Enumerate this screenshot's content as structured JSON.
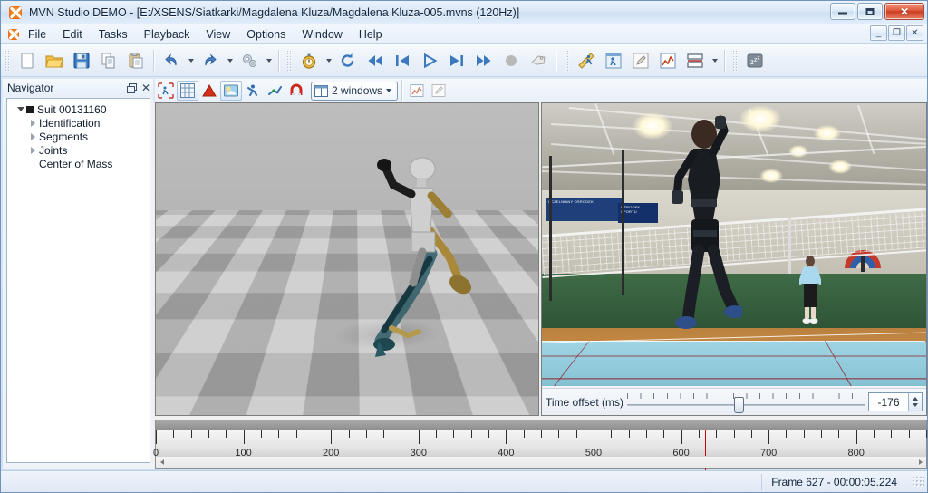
{
  "window": {
    "title": "MVN Studio DEMO - [E:/XSENS/Siatkarki/Magdalena Kluza/Magdalena Kluza-005.mvns  (120Hz)]",
    "app_icon": "xsens-logo-icon",
    "minimize_label": "–",
    "maximize_label": "□",
    "close_label": "✕",
    "mdi_minimize_label": "_",
    "mdi_restore_label": "❐",
    "mdi_close_label": "✕"
  },
  "menu": {
    "items": [
      {
        "label": "File"
      },
      {
        "label": "Edit"
      },
      {
        "label": "Tasks"
      },
      {
        "label": "Playback"
      },
      {
        "label": "View"
      },
      {
        "label": "Options"
      },
      {
        "label": "Window"
      },
      {
        "label": "Help"
      }
    ]
  },
  "main_toolbar": {
    "groups": [
      {
        "buttons": [
          {
            "name": "new-file-button",
            "icon": "new-document-icon",
            "caret": false
          },
          {
            "name": "open-file-button",
            "icon": "open-folder-icon",
            "caret": false
          },
          {
            "name": "save-file-button",
            "icon": "save-disk-icon",
            "caret": false
          },
          {
            "name": "copy-button",
            "icon": "copy-icon",
            "caret": false
          },
          {
            "name": "paste-button",
            "icon": "paste-icon",
            "caret": false
          }
        ]
      },
      {
        "buttons": [
          {
            "name": "undo-button",
            "icon": "undo-arrow-icon",
            "caret": true
          },
          {
            "name": "redo-button",
            "icon": "redo-arrow-icon",
            "caret": true
          },
          {
            "name": "reprocess-button",
            "icon": "gears-icon",
            "caret": true
          }
        ]
      },
      {
        "buttons": [
          {
            "name": "record-timer-button",
            "icon": "stopwatch-icon",
            "caret": true
          },
          {
            "name": "reset-button",
            "icon": "circular-reset-icon",
            "caret": false
          },
          {
            "name": "go-to-start-button",
            "icon": "skip-first-icon",
            "caret": false
          },
          {
            "name": "step-back-button",
            "icon": "step-previous-icon",
            "caret": false
          },
          {
            "name": "play-button",
            "icon": "play-icon",
            "caret": false
          },
          {
            "name": "step-forward-button",
            "icon": "step-next-icon",
            "caret": false
          },
          {
            "name": "go-to-end-button",
            "icon": "skip-last-icon",
            "caret": false
          },
          {
            "name": "record-button",
            "icon": "record-circle-icon",
            "caret": false
          },
          {
            "name": "marker-button",
            "icon": "tag-label-icon",
            "caret": false
          }
        ]
      },
      {
        "buttons": [
          {
            "name": "calibration-button",
            "icon": "ruler-runner-icon",
            "caret": false
          },
          {
            "name": "single-level-button",
            "icon": "framed-runner-icon",
            "caret": false
          },
          {
            "name": "edit-notes-button",
            "icon": "pencil-note-icon",
            "caret": false
          },
          {
            "name": "graph-button",
            "icon": "graph-chart-icon",
            "caret": false
          },
          {
            "name": "layout-button",
            "icon": "split-layout-icon",
            "caret": true
          }
        ]
      },
      {
        "buttons": [
          {
            "name": "standby-button",
            "icon": "sleep-zzz-icon",
            "caret": false
          }
        ]
      }
    ]
  },
  "view_toolbar": {
    "buttons": [
      {
        "name": "fit-to-view-button",
        "icon": "fit-runner-icon",
        "active": false
      },
      {
        "name": "toggle-grid-button",
        "icon": "grid-icon",
        "active": true
      },
      {
        "name": "toggle-contact-button",
        "icon": "red-triangle-icon",
        "active": false
      },
      {
        "name": "toggle-environment-button",
        "icon": "sky-cloud-icon",
        "active": true
      },
      {
        "name": "toggle-character-button",
        "icon": "runner-icon",
        "active": false
      },
      {
        "name": "toggle-skeleton-button",
        "icon": "skeleton-stick-icon",
        "active": false
      },
      {
        "name": "toggle-magnet-button",
        "icon": "magnet-icon",
        "active": false
      }
    ],
    "window_count": {
      "value": "2 windows",
      "icon": "two-pane-icon"
    },
    "trailing_buttons": [
      {
        "name": "graph-view-button",
        "icon": "graph-chart-icon"
      },
      {
        "name": "annotate-button",
        "icon": "pencil-note-icon"
      }
    ]
  },
  "navigator": {
    "title": "Navigator",
    "float_icon": "restore-pane-icon",
    "close_icon": "close-pane-icon",
    "tree": [
      {
        "label": "Suit 00131160",
        "expander": "down",
        "swatch": true,
        "indent": 0
      },
      {
        "label": "Identification",
        "expander": "right",
        "swatch": false,
        "indent": 1
      },
      {
        "label": "Segments",
        "expander": "right",
        "swatch": false,
        "indent": 1
      },
      {
        "label": "Joints",
        "expander": "right",
        "swatch": false,
        "indent": 1
      },
      {
        "label": "Center of Mass",
        "expander": "none",
        "swatch": false,
        "indent": 1
      }
    ]
  },
  "viewport_3d": {
    "name": "3d-viewport",
    "description": "3D motion capture avatar on checkered ground plane"
  },
  "video_pane": {
    "name": "video-viewport",
    "description": "Volleyball gym video: player spiking over net",
    "banner_text_1": "UCZELNIANY OŚRODEK",
    "banner_text_2": "OŚRODEK SPORTU",
    "time_offset": {
      "label": "Time offset (ms)",
      "value": "-176",
      "slider_percent": 45
    }
  },
  "timeline": {
    "name": "timeline-ruler",
    "major_labels": [
      "0",
      "100",
      "200",
      "300",
      "400",
      "500",
      "600",
      "700",
      "800"
    ],
    "frame_start": 0,
    "frame_end": 880,
    "minor_tick_interval": 20,
    "major_tick_interval": 100,
    "playhead_frame": 627,
    "playhead_color": "#cc0000",
    "scroll_left_icon": "scroll-left-arrow-icon",
    "scroll_right_icon": "scroll-right-arrow-icon"
  },
  "status_bar": {
    "frame_text": "Frame 627 - 00:00:05.224",
    "resize_grip_icon": "resize-grip-icon"
  },
  "colors": {
    "accent": "#1e3f7a",
    "playhead": "#cc0000",
    "title_text": "#13253c",
    "logo_orange": "#f07c18"
  }
}
